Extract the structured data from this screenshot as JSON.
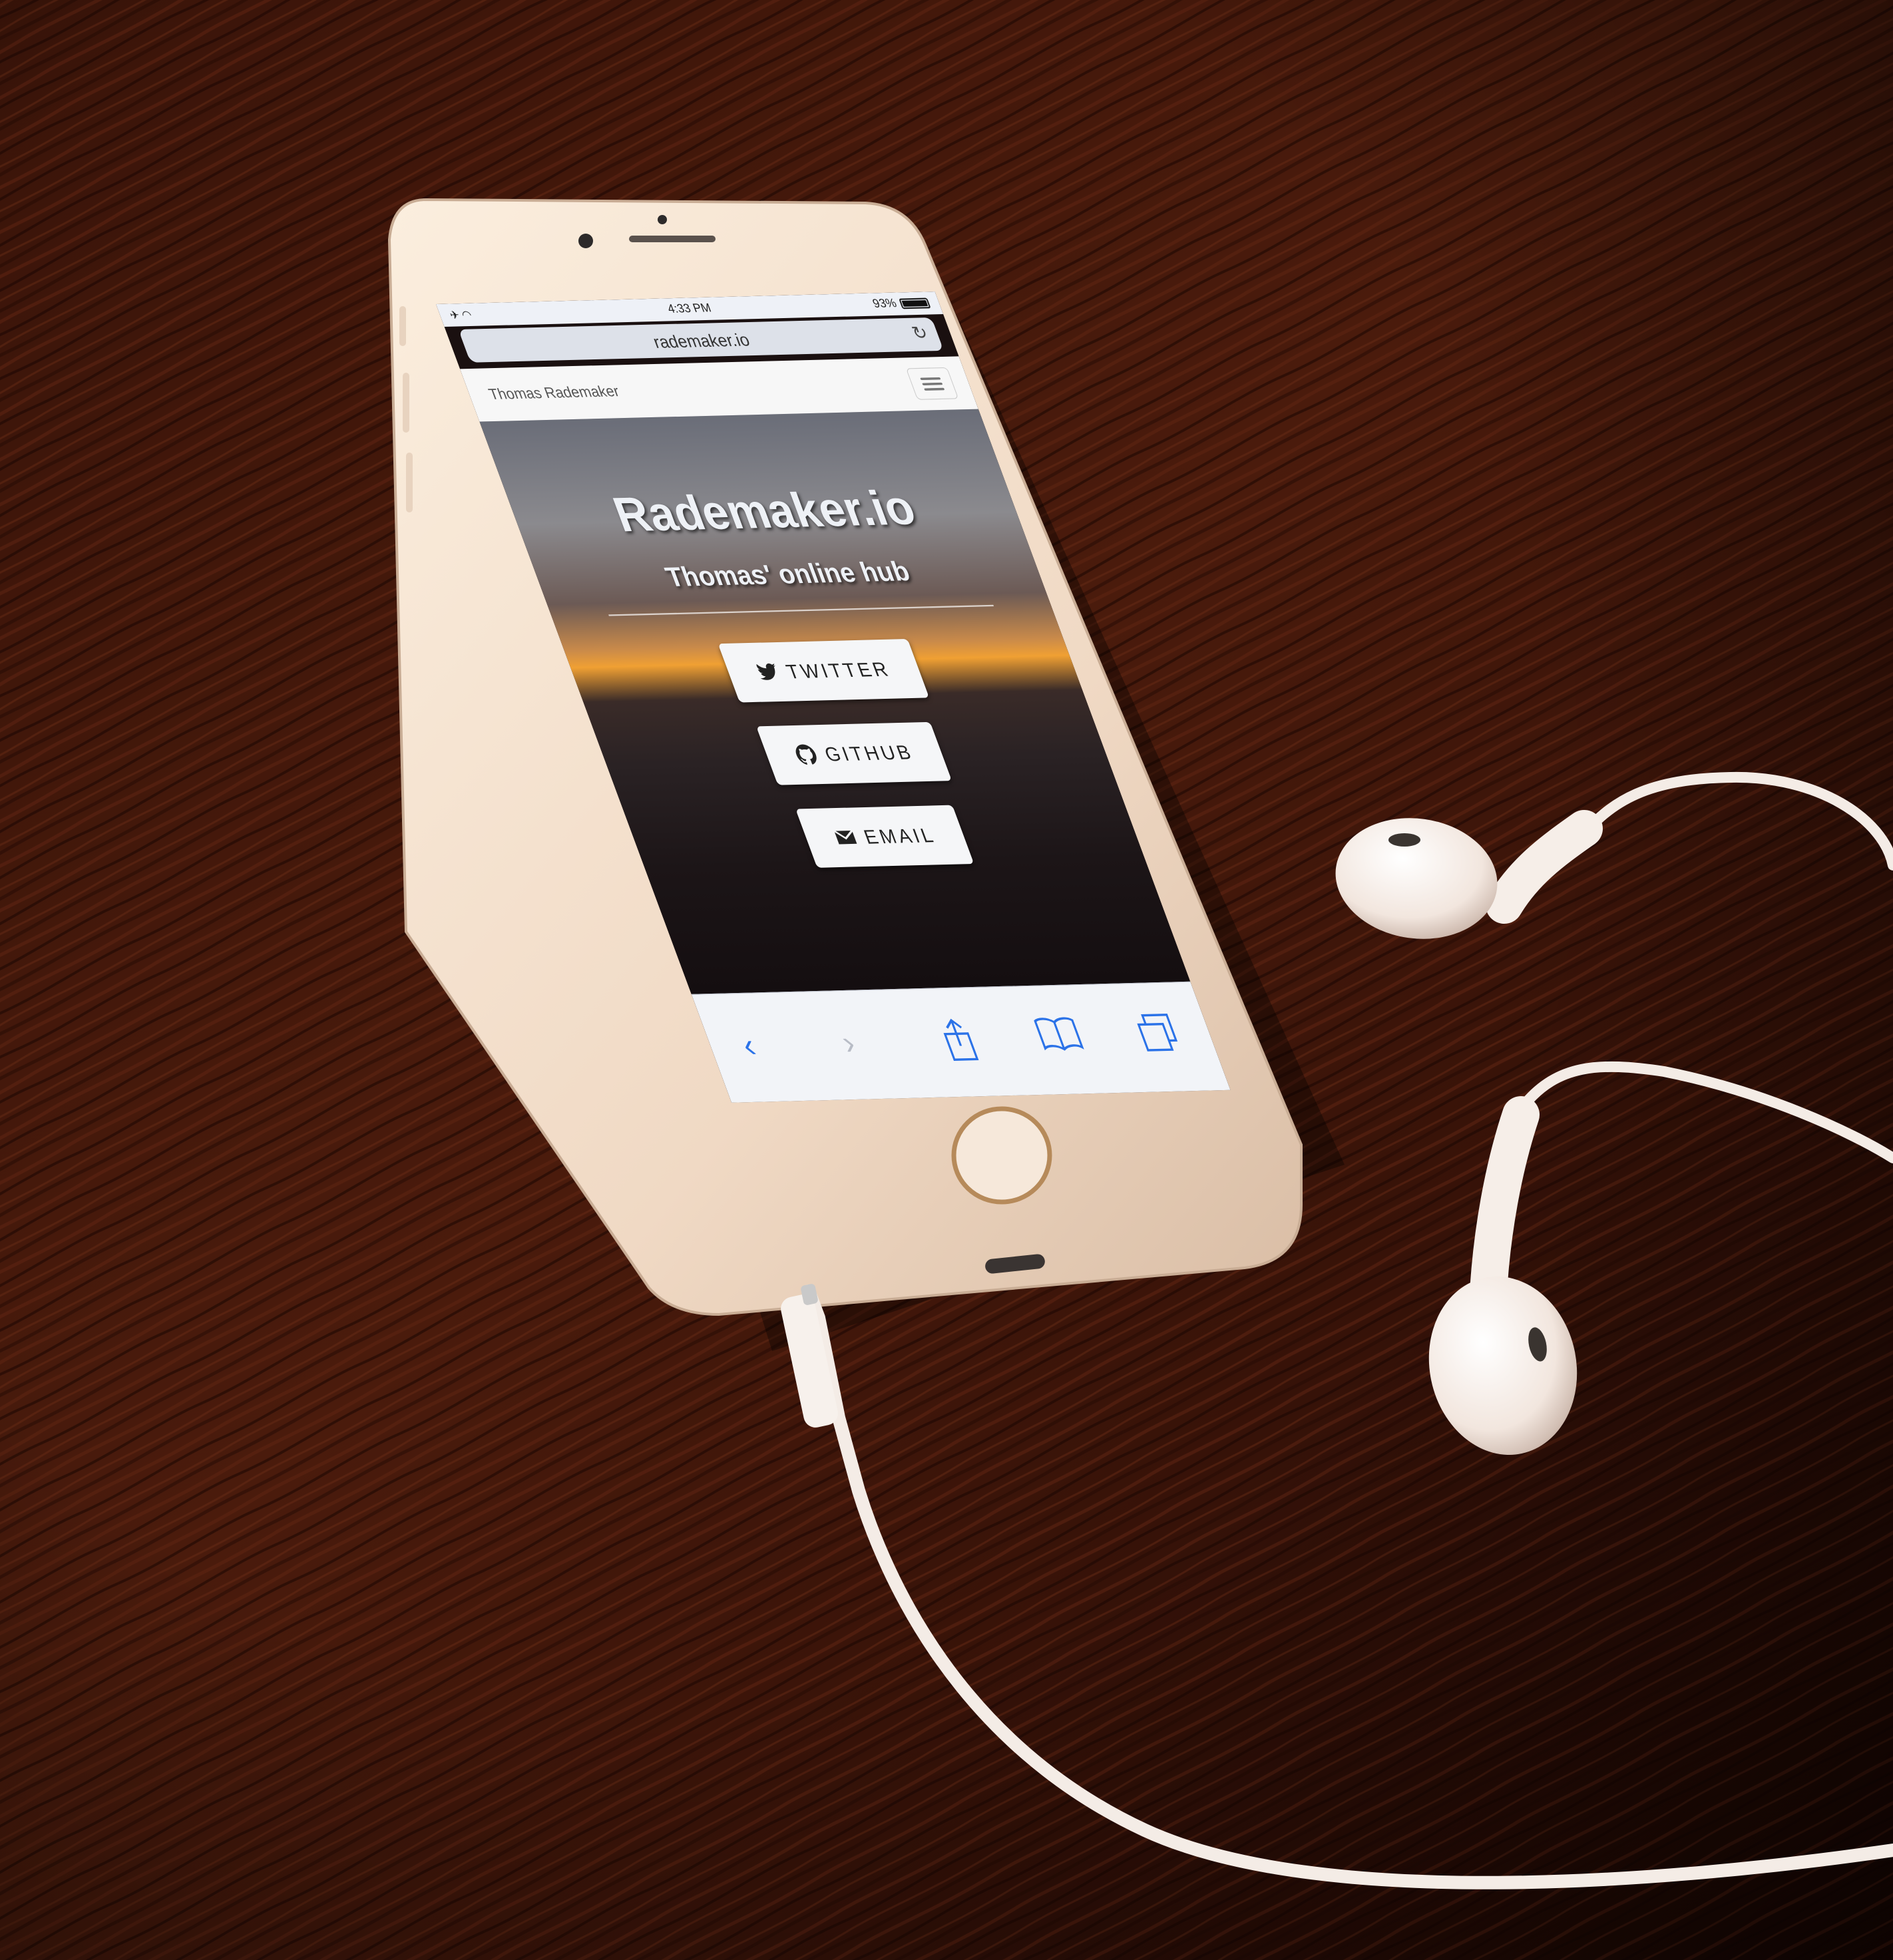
{
  "status_bar": {
    "time": "4:33 PM",
    "battery": "93%",
    "battery_level": 0.93,
    "airplane_icon": "airplane-icon",
    "wifi_icon": "wifi-icon"
  },
  "browser": {
    "url": "rademaker.io",
    "reload_icon": "reload-icon",
    "toolbar": {
      "back_icon": "chevron-left-icon",
      "forward_icon": "chevron-right-icon",
      "share_icon": "share-icon",
      "bookmarks_icon": "book-icon",
      "tabs_icon": "tabs-icon"
    }
  },
  "site": {
    "brand": "Thomas Rademaker",
    "menu_icon": "hamburger-icon",
    "hero": {
      "title": "Rademaker.io",
      "subtitle": "Thomas' online hub"
    },
    "buttons": [
      {
        "label": "TWITTER",
        "icon": "twitter-icon"
      },
      {
        "label": "GITHUB",
        "icon": "github-icon"
      },
      {
        "label": "EMAIL",
        "icon": "envelope-icon"
      }
    ]
  },
  "colors": {
    "table": "#2a0d06",
    "phone_body": "#f3e1cf",
    "accent_blue": "#2b72e8",
    "button_bg": "#f5f6f8"
  }
}
